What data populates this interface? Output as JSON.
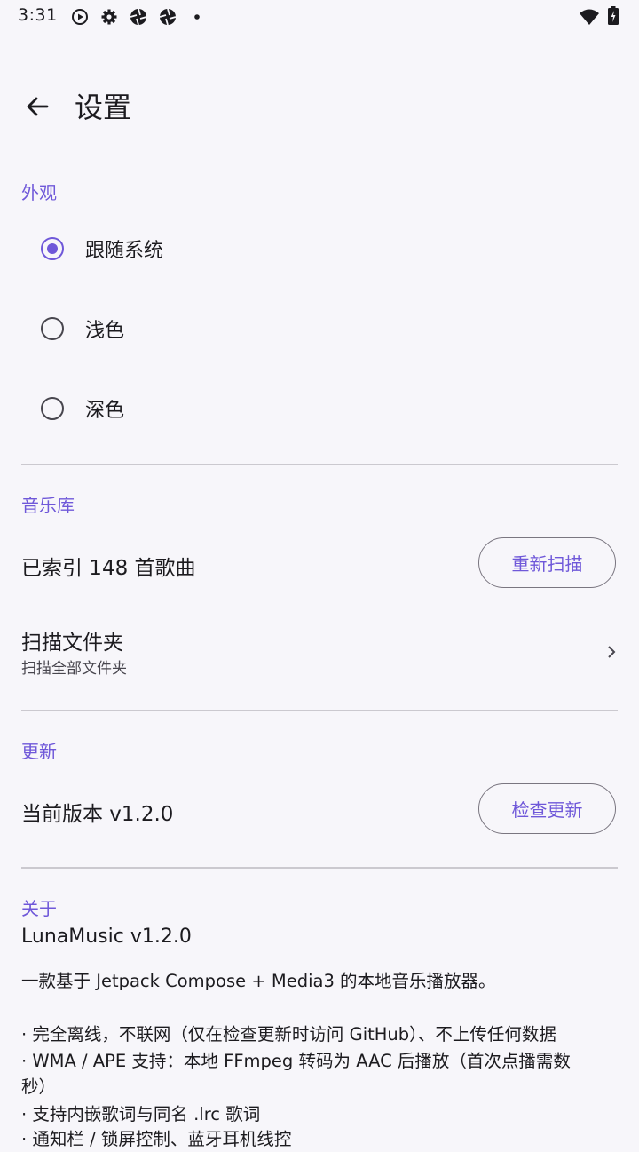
{
  "status_bar": {
    "time": "3:31"
  },
  "header": {
    "title": "设置"
  },
  "appearance": {
    "heading": "外观",
    "options": [
      {
        "label": "跟随系统",
        "selected": true
      },
      {
        "label": "浅色",
        "selected": false
      },
      {
        "label": "深色",
        "selected": false
      }
    ]
  },
  "library": {
    "heading": "音乐库",
    "indexed_text": "已索引 148 首歌曲",
    "rescan_label": "重新扫描",
    "folder_title": "扫描文件夹",
    "folder_sub": "扫描全部文件夹"
  },
  "update": {
    "heading": "更新",
    "version_text": "当前版本 v1.2.0",
    "check_label": "检查更新"
  },
  "about": {
    "heading": "关于",
    "app_name": "LunaMusic v1.2.0",
    "description": "一款基于 Jetpack Compose + Media3 的本地音乐播放器。",
    "features": [
      "· 完全离线，不联网（仅在检查更新时访问 GitHub）、不上传任何数据",
      "· WMA / APE 支持：本地 FFmpeg 转码为 AAC 后播放（首次点播需数",
      "秒）",
      "· 支持内嵌歌词与同名 .lrc 歌词",
      "· 通知栏 / 锁屏控制、蓝牙耳机线控"
    ]
  },
  "colors": {
    "accent": "#6f58d9",
    "background": "#f7f6fa",
    "divider": "#cbc9cf"
  }
}
